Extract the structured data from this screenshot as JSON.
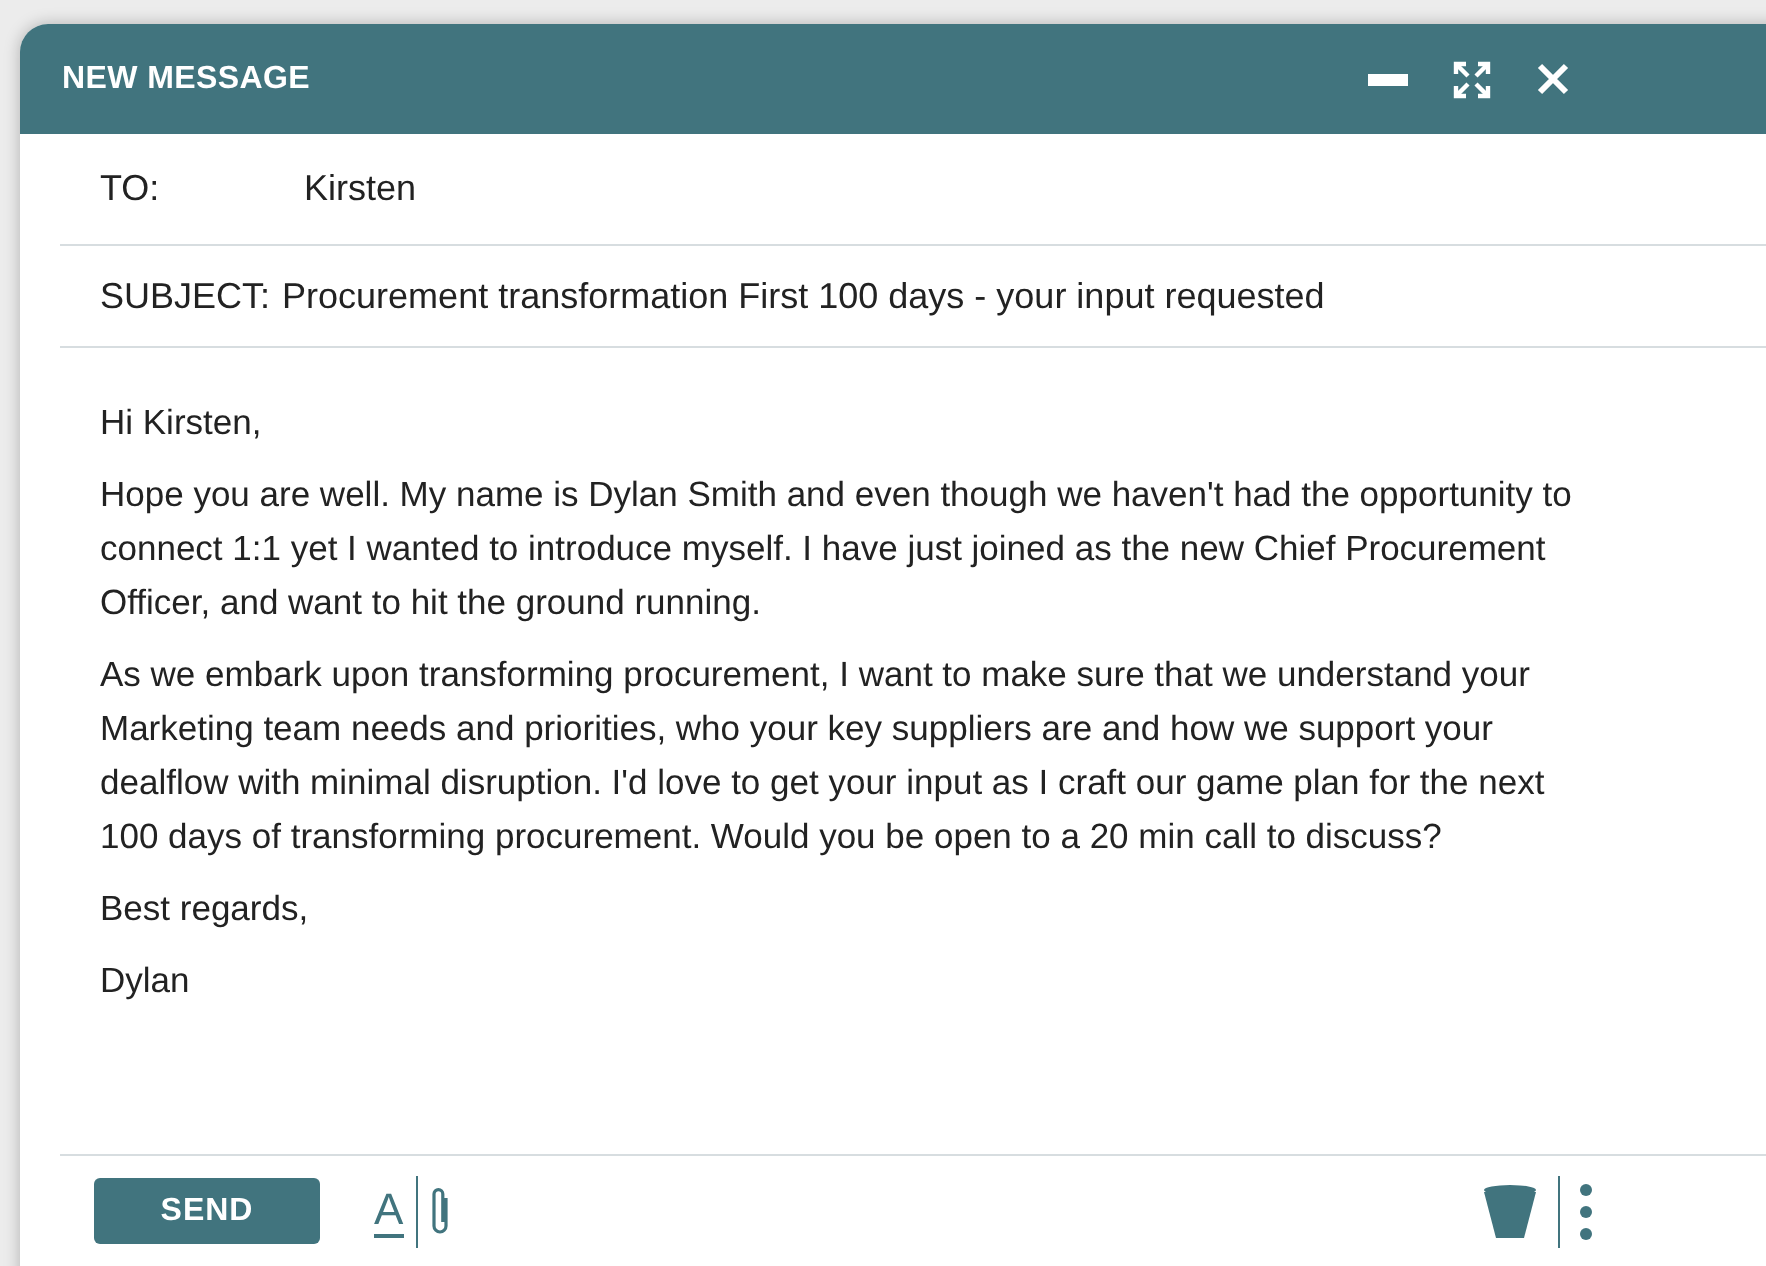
{
  "window": {
    "title": "NEW MESSAGE"
  },
  "to": {
    "label": "TO:",
    "value": "Kirsten"
  },
  "subject": {
    "label": "SUBJECT:",
    "value": "Procurement transformation First 100 days - your input requested"
  },
  "body": [
    "Hi Kirsten,",
    "Hope you are well. My name is Dylan Smith and even though we haven't had the opportunity to connect 1:1 yet I wanted to introduce myself. I have just joined as the new Chief Procurement Officer, and want to hit the ground running.",
    "As we embark upon transforming procurement, I want to make sure that we understand your Marketing team needs and priorities, who your key suppliers are and how we support your dealflow with minimal disruption. I'd love to get your input as I craft our game plan for the next 100 days of transforming procurement. Would you be open to a 20 min call to discuss?",
    "Best regards,",
    "Dylan"
  ],
  "toolbar": {
    "send": "SEND",
    "format": "A"
  }
}
